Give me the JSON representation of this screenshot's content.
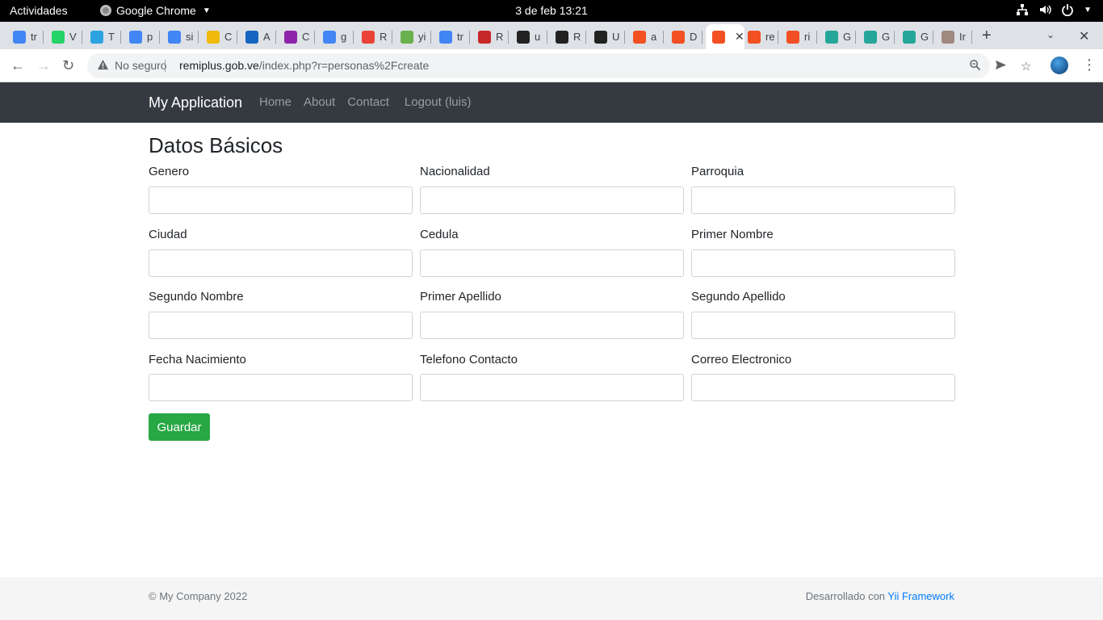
{
  "os_topbar": {
    "activities": "Actividades",
    "app_name": "Google Chrome",
    "clock": "3 de feb  13:21"
  },
  "tabs": [
    {
      "letter": "tr",
      "icon": "google-icon",
      "color": "#4285f4"
    },
    {
      "letter": "V",
      "icon": "whatsapp-icon",
      "color": "#25d366"
    },
    {
      "letter": "T",
      "icon": "telegram-icon",
      "color": "#2aa3e0"
    },
    {
      "letter": "p",
      "icon": "google-icon",
      "color": "#4285f4"
    },
    {
      "letter": "si",
      "icon": "google-icon",
      "color": "#4285f4"
    },
    {
      "letter": "C",
      "icon": "binance-icon",
      "color": "#f0b90b"
    },
    {
      "letter": "A",
      "icon": "a-icon",
      "color": "#1565c0"
    },
    {
      "letter": "C",
      "icon": "u-icon",
      "color": "#8e24aa"
    },
    {
      "letter": "g",
      "icon": "google-icon",
      "color": "#4285f4"
    },
    {
      "letter": "R",
      "icon": "gmail-icon",
      "color": "#ea4335"
    },
    {
      "letter": "yi",
      "icon": "yii-icon",
      "color": "#6ab04c"
    },
    {
      "letter": "tr",
      "icon": "google-icon",
      "color": "#4285f4"
    },
    {
      "letter": "R",
      "icon": "r-icon",
      "color": "#c62828"
    },
    {
      "letter": "u",
      "icon": "p-icon",
      "color": "#222222"
    },
    {
      "letter": "R",
      "icon": "p-icon",
      "color": "#222222"
    },
    {
      "letter": "U",
      "icon": "p-icon",
      "color": "#222222"
    },
    {
      "letter": "a",
      "icon": "microsoft-icon",
      "color": "#f25022"
    },
    {
      "letter": "D",
      "icon": "microsoft-icon",
      "color": "#f25022"
    },
    {
      "letter": "",
      "icon": "microsoft-icon",
      "color": "#f25022",
      "active": true
    },
    {
      "letter": "re",
      "icon": "microsoft-icon",
      "color": "#f25022"
    },
    {
      "letter": "ri",
      "icon": "microsoft-icon",
      "color": "#f25022"
    },
    {
      "letter": "G",
      "icon": "globe-icon",
      "color": "#26a69a"
    },
    {
      "letter": "G",
      "icon": "globe-icon",
      "color": "#26a69a"
    },
    {
      "letter": "G",
      "icon": "globe-icon",
      "color": "#26a69a"
    },
    {
      "letter": "Ir",
      "icon": "person-icon",
      "color": "#a1887f"
    }
  ],
  "omnibox": {
    "security": "No seguro",
    "domain": "remiplus.gob.ve",
    "path": "/index.php?r=personas%2Fcreate"
  },
  "navbar": {
    "brand": "My Application",
    "links": [
      "Home",
      "About",
      "Contact",
      "Logout (luis)"
    ]
  },
  "form": {
    "title": "Datos Básicos",
    "fields": [
      {
        "label": "Genero",
        "value": ""
      },
      {
        "label": "Nacionalidad",
        "value": ""
      },
      {
        "label": "Parroquia",
        "value": ""
      },
      {
        "label": "Ciudad",
        "value": ""
      },
      {
        "label": "Cedula",
        "value": ""
      },
      {
        "label": "Primer Nombre",
        "value": ""
      },
      {
        "label": "Segundo Nombre",
        "value": ""
      },
      {
        "label": "Primer Apellido",
        "value": ""
      },
      {
        "label": "Segundo Apellido",
        "value": ""
      },
      {
        "label": "Fecha Nacimiento",
        "value": ""
      },
      {
        "label": "Telefono Contacto",
        "value": ""
      },
      {
        "label": "Correo Electronico",
        "value": ""
      }
    ],
    "submit": "Guardar"
  },
  "footer": {
    "copyright": "© My Company 2022",
    "powered_prefix": "Desarrollado con ",
    "powered_link": "Yii Framework"
  },
  "colors": {
    "navbar_bg": "#343a40",
    "button_green": "#28a745",
    "link_blue": "#007bff"
  }
}
